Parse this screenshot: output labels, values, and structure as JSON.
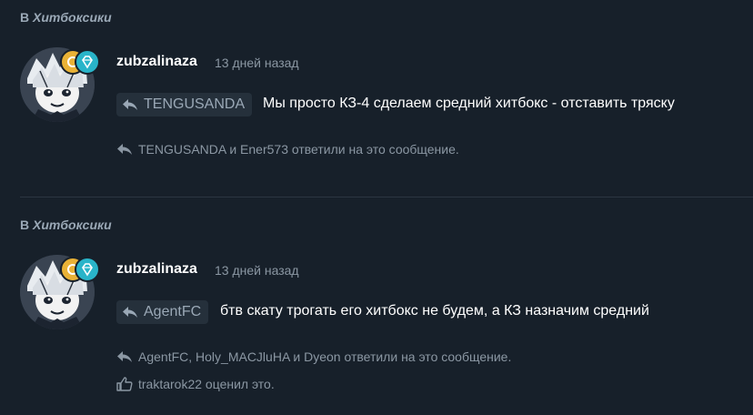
{
  "posts": [
    {
      "section_prefix": "В",
      "section_name": "Хитбоксики",
      "author": "zubzalinaza",
      "time": "13 дней назад",
      "quote_author": "TENGUSANDA",
      "message": "Мы просто КЗ-4 сделаем средний хитбокс - отставить тряску",
      "replies": "TENGUSANDA и Ener573 ответили на это сообщение."
    },
    {
      "section_prefix": "В",
      "section_name": "Хитбоксики",
      "author": "zubzalinaza",
      "time": "13 дней назад",
      "quote_author": "AgentFC",
      "message": "бтв скату трогать его хитбокс не будем, а КЗ назначим средний",
      "replies": "AgentFC, Holy_MACJluHA и Dyeon ответили на это сообщение.",
      "likes": "traktarok22 оценил это."
    }
  ],
  "icons": {
    "reply": "reply-arrow-icon",
    "like": "thumbs-up-icon",
    "badge_gold": "trophy-badge-icon",
    "badge_gem": "diamond-badge-icon"
  },
  "colors": {
    "background": "#17202a",
    "muted_text": "#8b97a3",
    "gold_badge": "#e9b236",
    "gem_badge": "#29b4c9"
  }
}
